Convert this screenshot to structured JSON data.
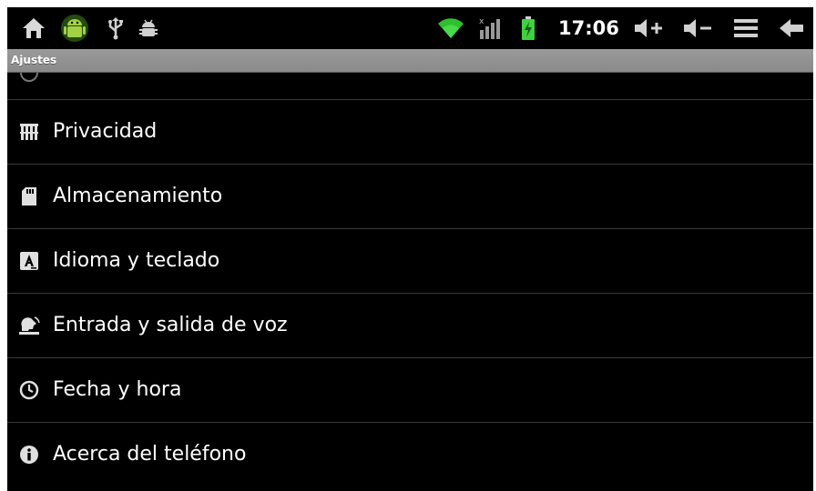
{
  "status_bar": {
    "time": "17:06",
    "left_icons": [
      "home-icon",
      "android-icon",
      "usb-icon",
      "debug-bug-icon"
    ],
    "right_icons": [
      "wifi-icon",
      "signal-icon",
      "battery-charging-icon",
      "volume-up-icon",
      "volume-down-icon",
      "menu-icon",
      "back-icon"
    ]
  },
  "title_bar": {
    "title": "Ajustes"
  },
  "settings": {
    "items": [
      {
        "label": "Privacidad",
        "icon": "privacy-icon"
      },
      {
        "label": "Almacenamiento",
        "icon": "sd-card-icon"
      },
      {
        "label": "Idioma y teclado",
        "icon": "language-icon"
      },
      {
        "label": "Entrada y salida de voz",
        "icon": "voice-icon"
      },
      {
        "label": "Fecha y hora",
        "icon": "clock-icon"
      },
      {
        "label": "Acerca del teléfono",
        "icon": "info-icon"
      }
    ]
  },
  "colors": {
    "background": "#000000",
    "title_bar": "#8f8f8f",
    "divider": "#3a3a3a",
    "text": "#ffffff",
    "wifi": "#33cc33",
    "battery": "#44dd44"
  }
}
